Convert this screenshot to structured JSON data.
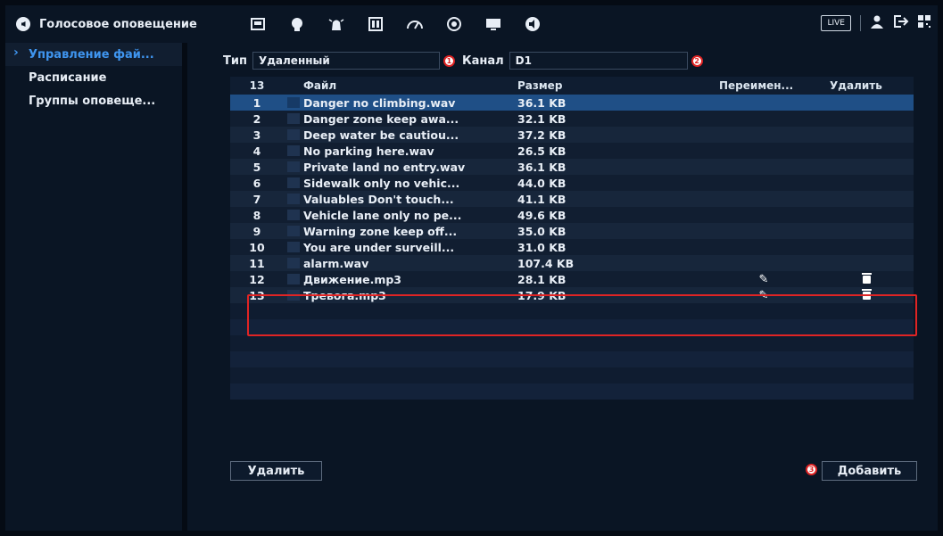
{
  "header": {
    "title": "Голосовое оповещение",
    "icons": [
      "speaker-icon",
      "camera-settings-icon",
      "network-icon",
      "alarm-light-icon",
      "storage-icon",
      "speed-icon",
      "record-icon",
      "display-icon",
      "audio-icon"
    ],
    "live_label": "LIVE"
  },
  "sidebar": {
    "items": [
      {
        "label": "Управление фай...",
        "active": true
      },
      {
        "label": "Расписание",
        "active": false
      },
      {
        "label": "Группы оповеще...",
        "active": false
      }
    ]
  },
  "filters": {
    "type_label": "Тип",
    "type_value": "Удаленный",
    "type_marker": "1",
    "channel_label": "Канал",
    "channel_value": "D1",
    "channel_marker": "2"
  },
  "table": {
    "headers": {
      "num": "13",
      "file": "Файл",
      "size": "Размер",
      "rename": "Переимен...",
      "delete": "Удалить"
    },
    "rows": [
      {
        "num": "1",
        "file": "Danger no climbing.wav",
        "size": "36.1 KB"
      },
      {
        "num": "2",
        "file": "Danger zone keep awa...",
        "size": "32.1 KB"
      },
      {
        "num": "3",
        "file": "Deep water be cautiou...",
        "size": "37.2 KB"
      },
      {
        "num": "4",
        "file": "No parking here.wav",
        "size": "26.5 KB"
      },
      {
        "num": "5",
        "file": "Private land no entry.wav",
        "size": "36.1 KB"
      },
      {
        "num": "6",
        "file": "Sidewalk only no vehic...",
        "size": "44.0 KB"
      },
      {
        "num": "7",
        "file": "Valuables Don't touch...",
        "size": "41.1 KB"
      },
      {
        "num": "8",
        "file": "Vehicle lane only no pe...",
        "size": "49.6 KB"
      },
      {
        "num": "9",
        "file": "Warning zone keep off...",
        "size": "35.0 KB"
      },
      {
        "num": "10",
        "file": "You are under surveill...",
        "size": "31.0 KB"
      },
      {
        "num": "11",
        "file": "alarm.wav",
        "size": "107.4 KB"
      },
      {
        "num": "12",
        "file": "Движение.mp3",
        "size": "28.1 KB"
      },
      {
        "num": "13",
        "file": "Тревога.mp3",
        "size": "17.9 KB"
      }
    ]
  },
  "buttons": {
    "delete_label": "Удалить",
    "add_label": "Добавить",
    "add_marker": "3"
  },
  "colors": {
    "accent": "#3f95ef",
    "selected_row": "#1f4f86",
    "highlight": "#e02424"
  }
}
